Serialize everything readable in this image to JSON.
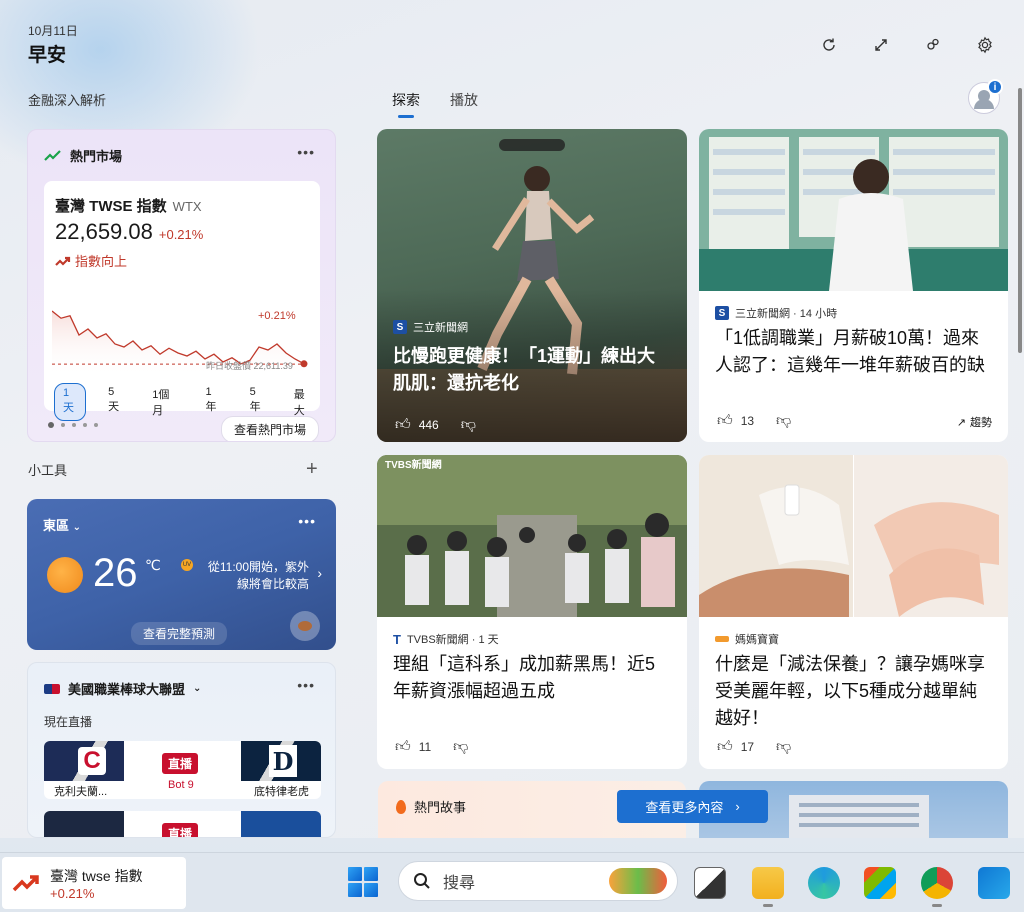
{
  "header": {
    "date": "10月11日",
    "greeting": "早安",
    "icons": [
      "refresh-icon",
      "expand-icon",
      "people-icon",
      "gear-icon"
    ]
  },
  "left": {
    "section_finance": "金融深入解析",
    "market": {
      "title": "熱門市場",
      "index_name": "臺灣 TWSE 指數",
      "index_code": "WTX",
      "value": "22,659.08",
      "change": "+0.21%",
      "trend": "指數向上",
      "chart_change": "+0.21%",
      "prev_close": "昨日收盤價 22,611.39",
      "ranges": [
        "1天",
        "5天",
        "1個月",
        "1年",
        "5年",
        "最大"
      ],
      "active_range": "1天",
      "see_market": "查看熱門市場"
    },
    "section_widgets": "小工具",
    "add_icon": "+",
    "weather": {
      "location": "東區",
      "temp": "26",
      "unit": "℃",
      "uv_label": "UV",
      "note": "從11:00開始，紫外線將會比較高",
      "forecast_btn": "查看完整預測"
    },
    "mlb": {
      "title": "美國職業棒球大聯盟",
      "live_label": "現在直播",
      "games": [
        {
          "home_logo": "C",
          "away_logo": "D",
          "status": "直播",
          "inning": "Bot 9",
          "home": "克利夫蘭...",
          "away": "底特律老虎"
        },
        {
          "status": "直播"
        }
      ]
    }
  },
  "tabs": {
    "items": [
      "探索",
      "播放"
    ],
    "active": "探索"
  },
  "avatar_badge": "i",
  "news": [
    {
      "source": "三立新聞網",
      "title": "比慢跑更健康！「1運動」練出大肌肌：還抗老化",
      "likes": "446"
    },
    {
      "source": "三立新聞網 · 14 小時",
      "title": "「1低調職業」月薪破10萬！過來人認了：這幾年一堆年薪破百的缺",
      "likes": "13",
      "trend": "趨勢"
    },
    {
      "source": "TVBS新聞網 · 1 天",
      "logo": "TVBS新聞網",
      "title": "理組「這科系」成加薪黑馬！近5年薪資漲幅超過五成",
      "likes": "11"
    },
    {
      "source": "媽媽寶寶",
      "title": "什麼是「減法保養」？讓孕媽咪享受美麗年輕，以下5種成分越單純越好！",
      "likes": "17"
    }
  ],
  "hot_stories": "熱門故事",
  "see_more": "查看更多內容",
  "taskbar": {
    "widget_title": "臺灣 twse 指數",
    "widget_change": "+0.21%",
    "search_placeholder": "搜尋"
  },
  "colors": {
    "accent": "#1d6fd0",
    "negative": "#c0392b",
    "weather_bg": "#3e62a8"
  },
  "chart_data": {
    "type": "line",
    "series": [
      {
        "values": [
          22700,
          22688,
          22692,
          22660,
          22670,
          22655,
          22662,
          22645,
          22640,
          22650,
          22635,
          22642,
          22628,
          22638,
          22630,
          22625,
          22633,
          22620,
          22628,
          22615,
          22622,
          22612,
          22618,
          22640,
          22635,
          22645,
          22630,
          22620,
          22612
        ]
      }
    ],
    "reference_line": 22611.39,
    "ylim": [
      22590,
      22720
    ]
  }
}
